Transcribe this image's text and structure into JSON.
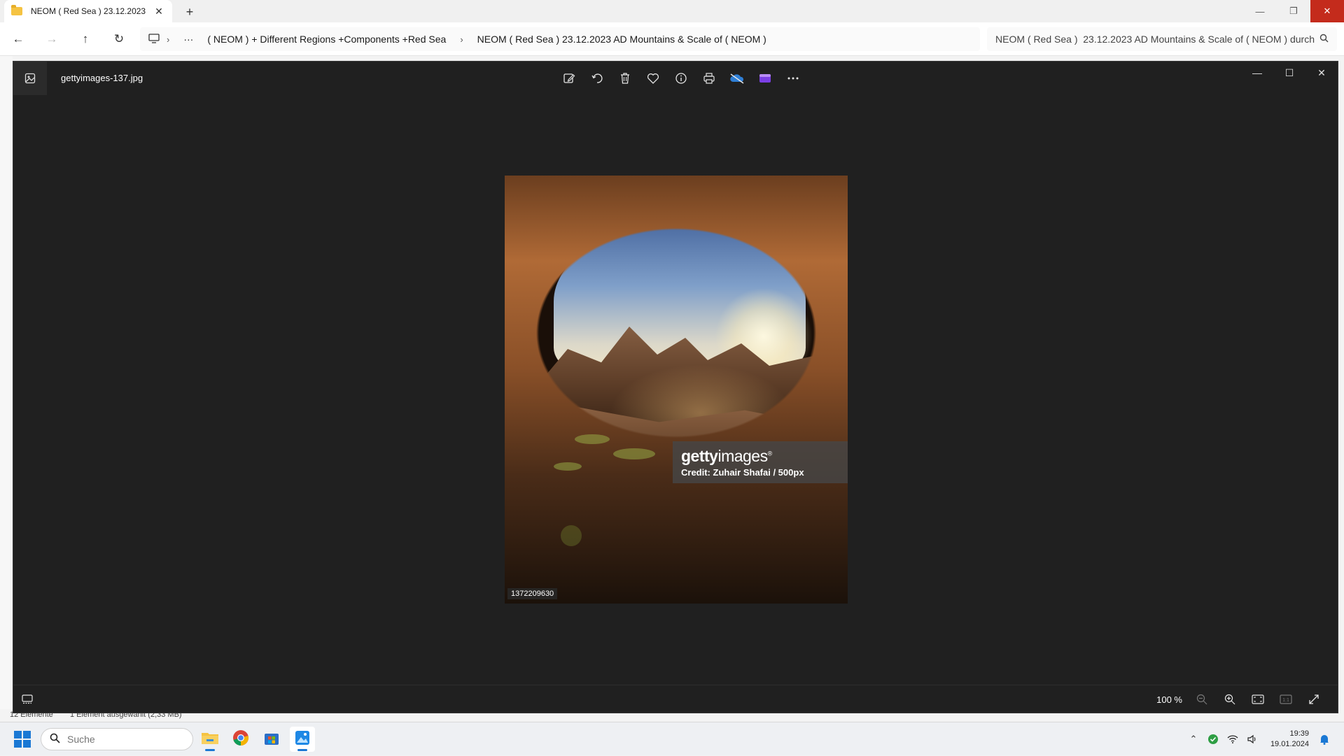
{
  "explorer": {
    "tab_title": "NEOM ( Red Sea )  23.12.2023",
    "breadcrumb": [
      "( NEOM ) + Different Regions +Components +Red Sea",
      "NEOM ( Red Sea )  23.12.2023 AD Mountains & Scale of ( NEOM )"
    ],
    "more_label": "···",
    "search_value": "NEOM ( Red Sea )  23.12.2023 AD Mountains & Scale of ( NEOM ) durch",
    "status_items": "12 Elemente",
    "status_selected": "1 Element ausgewählt (2,33 MB)"
  },
  "viewer": {
    "filename": "gettyimages-137.jpg",
    "tools": [
      "edit-icon",
      "rotate-icon",
      "delete-icon",
      "favorite-icon",
      "info-icon",
      "print-icon",
      "onedrive-icon",
      "clipchamp-icon",
      "more-icon"
    ],
    "zoom_level": "100 %",
    "photo": {
      "credit_logo_bold": "getty",
      "credit_logo_rest": "images",
      "credit_logo_mark": "®",
      "credit_text": "Credit: Zuhair Shafai / 500px",
      "photo_id": "1372209630"
    }
  },
  "taskbar": {
    "search_placeholder": "Suche",
    "time": "19:39",
    "date": "19.01.2024"
  },
  "colors": {
    "viewer_bg": "#202020",
    "accent": "#1a78d4",
    "close_red": "#c42b1c"
  }
}
